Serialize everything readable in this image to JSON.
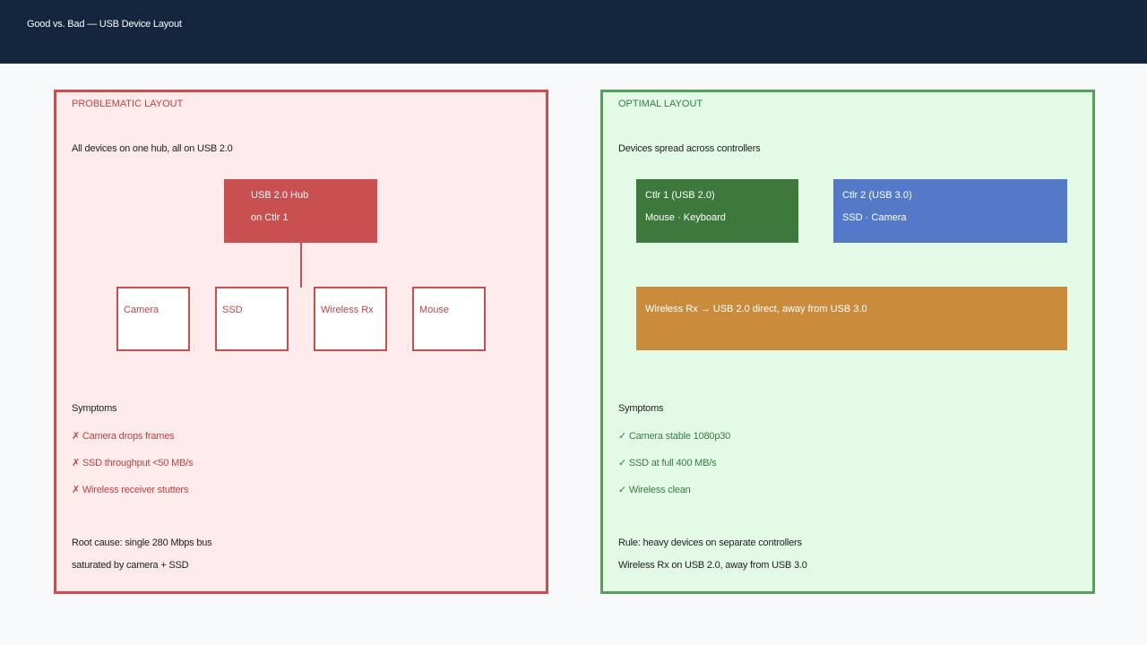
{
  "header": {
    "title": "Good vs. Bad — USB Device Layout"
  },
  "bad": {
    "heading": "PROBLEMATIC LAYOUT",
    "subtitle": "All devices on one hub, all on USB 2.0",
    "hub": {
      "line1": "USB 2.0 Hub",
      "line2": "on Ctlr 1"
    },
    "devices": [
      "Camera",
      "SSD",
      "Wireless Rx",
      "Mouse"
    ],
    "symptoms_title": "Symptoms",
    "symptoms": [
      "✗ Camera drops frames",
      "✗ SSD throughput <50 MB/s",
      "✗ Wireless receiver stutters"
    ],
    "note_line1": "Root cause: single 280 Mbps bus",
    "note_line2": "saturated by camera + SSD"
  },
  "good": {
    "heading": "OPTIMAL LAYOUT",
    "subtitle": "Devices spread across controllers",
    "ctrl1": {
      "title": "Ctlr 1  (USB 2.0)",
      "devices": "Mouse · Keyboard"
    },
    "ctrl2": {
      "title": "Ctlr 2  (USB 3.0)",
      "devices": "SSD · Camera"
    },
    "wireless": "Wireless Rx → USB 2.0 direct, away from USB 3.0",
    "symptoms_title": "Symptoms",
    "symptoms": [
      "✓ Camera stable 1080p30",
      "✓ SSD at full 400 MB/s",
      "✓ Wireless clean"
    ],
    "note_line1": "Rule: heavy devices on separate controllers",
    "note_line2": "Wireless Rx on USB 2.0, away from USB 3.0"
  },
  "colors": {
    "header": "#13263d",
    "bad_border": "#c84f4f",
    "bad_fill": "#fdeaea",
    "good_border": "#56a05a",
    "good_fill": "#e2fae6",
    "ctrl1": "#3d783d",
    "ctrl2": "#5479c9",
    "wireless": "#c88c3c"
  }
}
